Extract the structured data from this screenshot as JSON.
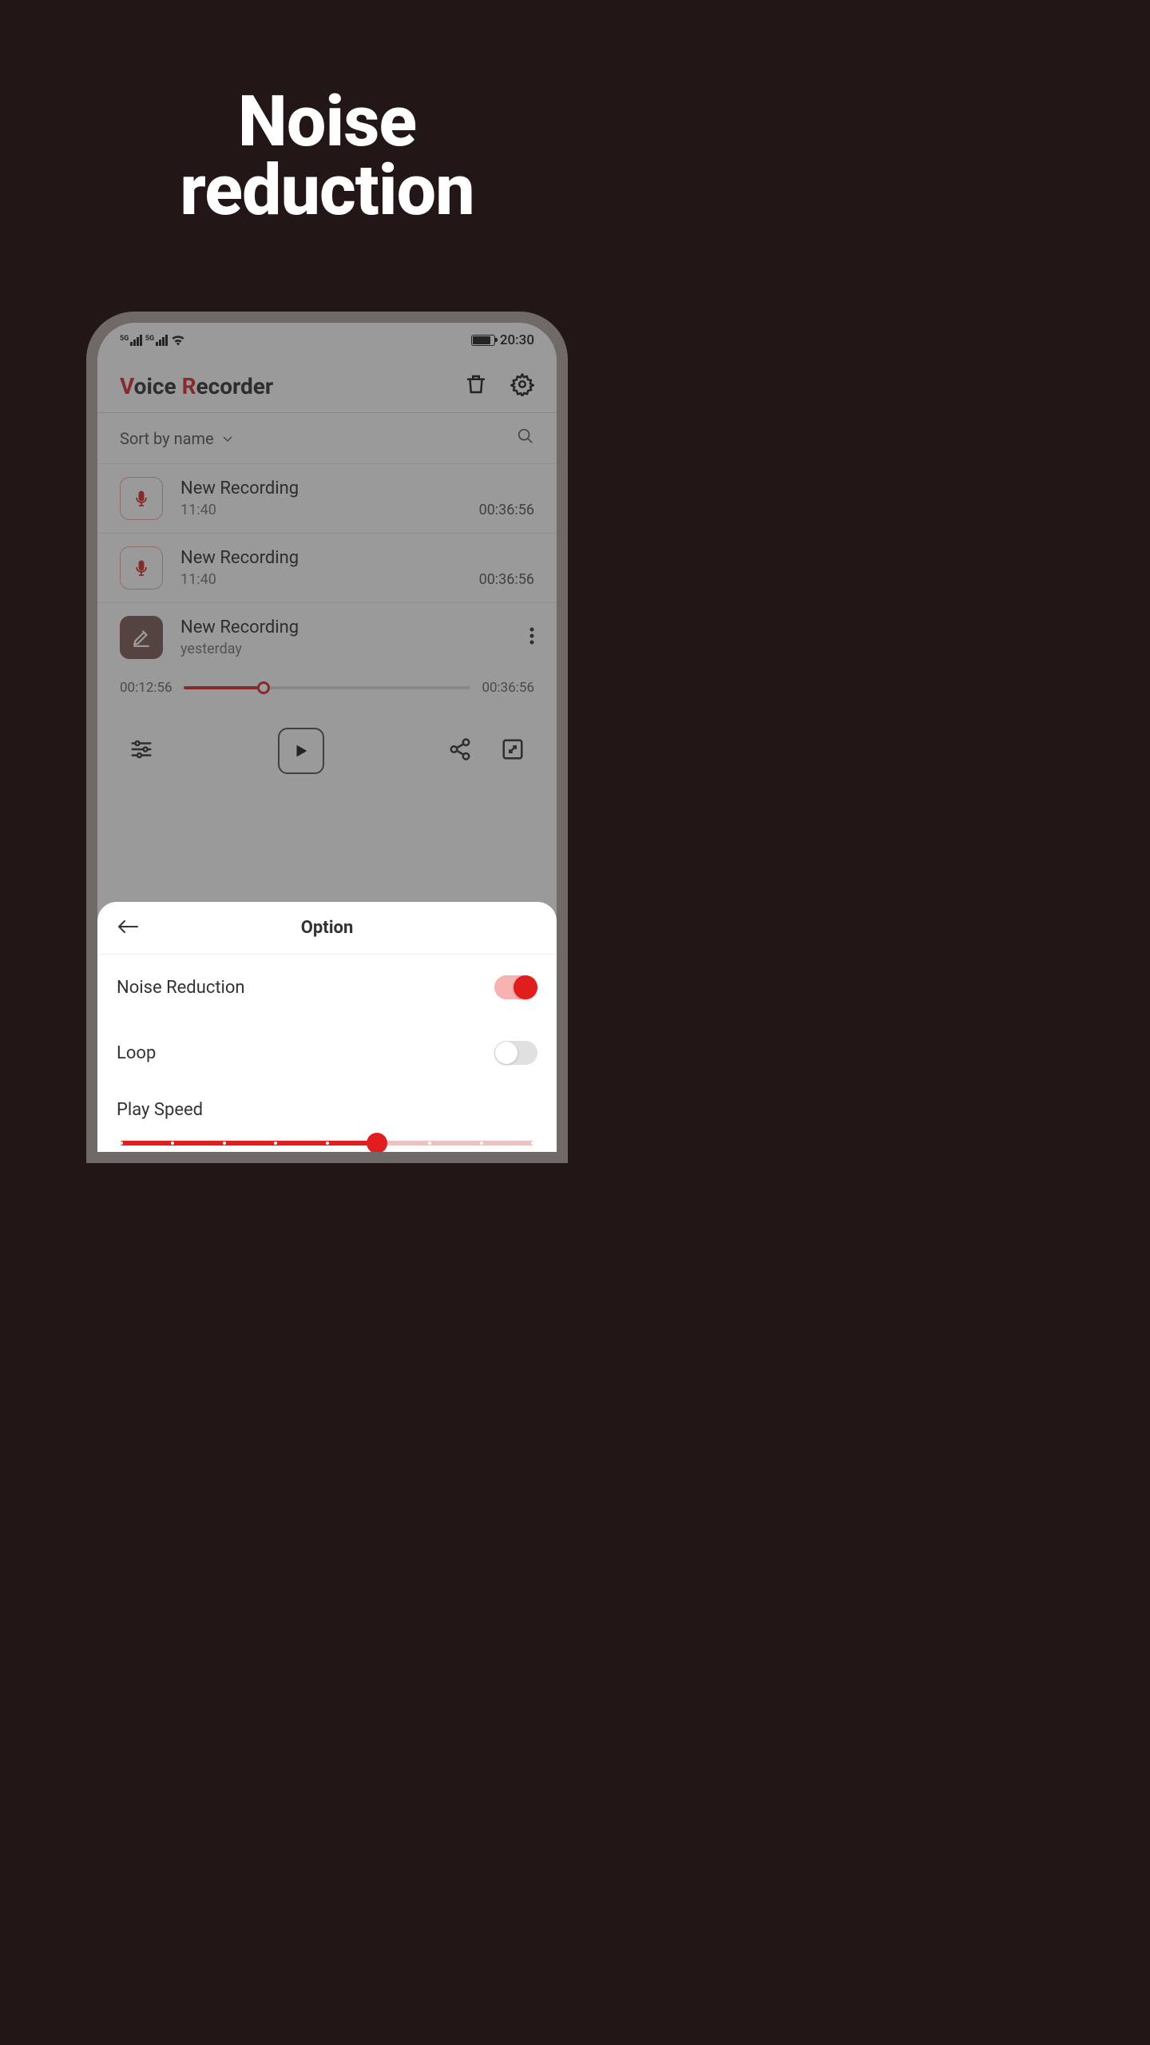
{
  "promo": {
    "line1": "Noise",
    "line2": "reduction"
  },
  "status": {
    "time": "20:30"
  },
  "header": {
    "title_v": "V",
    "title_oice": "oice ",
    "title_r": "R",
    "title_ecorder": "ecorder"
  },
  "sort": {
    "label": "Sort by name"
  },
  "recordings": [
    {
      "title": "New Recording",
      "time": "11:40",
      "duration": "00:36:56",
      "icon": "mic"
    },
    {
      "title": "New Recording",
      "time": "11:40",
      "duration": "00:36:56",
      "icon": "mic"
    },
    {
      "title": "New Recording",
      "time": "yesterday",
      "duration": "",
      "icon": "edit"
    }
  ],
  "player": {
    "elapsed": "00:12:56",
    "total": "00:36:56"
  },
  "sheet": {
    "title": "Option",
    "noise_reduction": "Noise Reduction",
    "loop": "Loop",
    "play_speed": "Play Speed"
  }
}
